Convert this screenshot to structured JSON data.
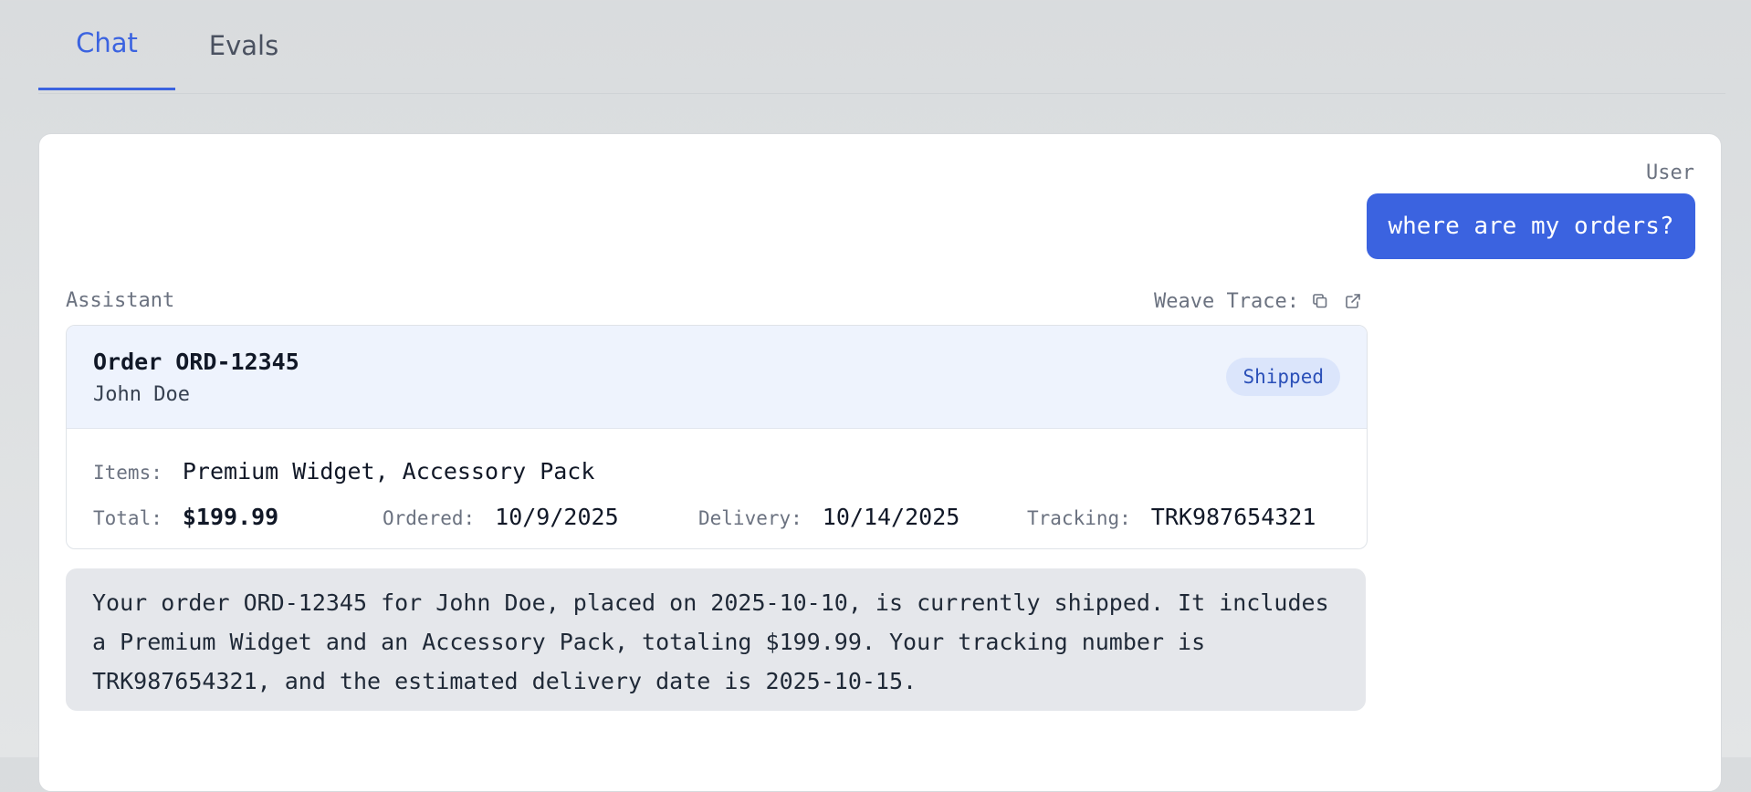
{
  "tabs": [
    {
      "label": "Chat",
      "active": true
    },
    {
      "label": "Evals",
      "active": false
    }
  ],
  "chat": {
    "user_role": "User",
    "user_message": "where are my orders?",
    "assistant_role": "Assistant",
    "weave_trace_label": "Weave Trace:",
    "icons": [
      "copy-icon",
      "external-link-icon"
    ],
    "order": {
      "title": "Order ORD-12345",
      "customer": "John Doe",
      "status": "Shipped",
      "items_label": "Items:",
      "items_value": "Premium Widget, Accessory Pack",
      "total_label": "Total:",
      "total_value": "$199.99",
      "ordered_label": "Ordered:",
      "ordered_value": "10/9/2025",
      "delivery_label": "Delivery:",
      "delivery_value": "10/14/2025",
      "tracking_label": "Tracking:",
      "tracking_value": "TRK987654321"
    },
    "assistant_message": "Your order ORD-12345 for John Doe, placed on 2025-10-10, is currently shipped. It includes a Premium Widget and an Accessory Pack, totaling $199.99. Your tracking number is TRK987654321, and the estimated delivery date is 2025-10-15."
  },
  "colors": {
    "accent": "#3b63e0",
    "status_badge_bg": "#dbe5fb",
    "status_badge_text": "#2a4fb8",
    "order_header_bg": "#eef3fd",
    "assistant_bubble_bg": "#e5e7eb"
  }
}
